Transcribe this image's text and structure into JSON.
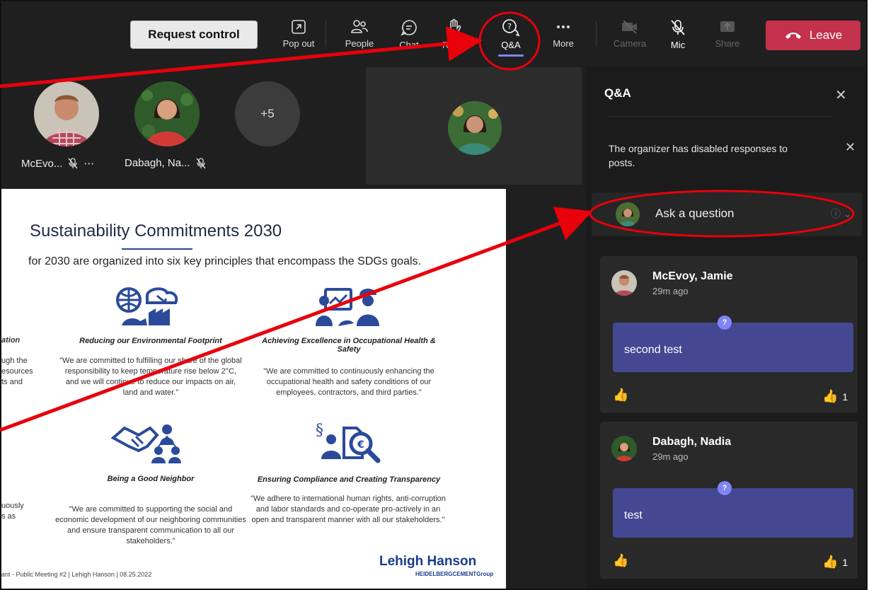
{
  "toolbar": {
    "request_control": "Request control",
    "buttons": [
      {
        "label": "Pop out",
        "icon": "pop-out-icon"
      },
      {
        "label": "People",
        "icon": "people-icon"
      },
      {
        "label": "Chat",
        "icon": "chat-icon"
      },
      {
        "label": "React",
        "icon": "hand-icon"
      },
      {
        "label": "Q&A",
        "icon": "qa-icon",
        "active": true
      },
      {
        "label": "More",
        "icon": "more-icon"
      },
      {
        "label": "Camera",
        "icon": "camera-icon",
        "disabled": true
      },
      {
        "label": "Mic",
        "icon": "mic-off-icon"
      },
      {
        "label": "Share",
        "icon": "share-icon",
        "disabled": true
      }
    ],
    "leave": "Leave"
  },
  "participants": [
    {
      "name": "McEvo...",
      "more": "⋯"
    },
    {
      "name": "Dabagh, Na..."
    }
  ],
  "overflow_count": "+5",
  "slide": {
    "title": "Sustainability Commitments 2030",
    "subtitle": "for 2030 are organized into six key principles that encompass the SDGs goals.",
    "clip_left_head": "ation",
    "clip_left_1": "ugh the",
    "clip_left_2": "esources",
    "clip_left_3": "ts and",
    "clip_left_4": "uously",
    "clip_left_5": "s as",
    "p1_head": "Reducing our Environmental Footprint",
    "p1_body": "\"We are committed to fulfilling our share of the global responsibility to keep temperature rise below 2°C, and we will continue to reduce our impacts on air, land and water.\"",
    "p2_head": "Achieving Excellence in Occupational Health & Safety",
    "p2_body": "\"We are committed to continuously enhancing the occupational health and safety conditions of our employees, contractors, and third parties.\"",
    "p3_head": "Being a Good Neighbor",
    "p3_body": "\"We are committed to supporting the social and economic development of our neighboring communities and ensure transparent communication to all our stakeholders.\"",
    "p4_head": "Ensuring Compliance and Creating Transparency",
    "p4_body": "\"We adhere to international human rights, anti-corruption and labor standards and co-operate pro-actively in an open and transparent manner with all our stakeholders.\"",
    "footer": "ant - Public Meeting #2  |  Lehigh Hanson  |  08.25.2022",
    "logo_main": "Lehigh Hanson",
    "logo_sub": "HEIDELBERGCEMENTGroup"
  },
  "qa": {
    "title": "Q&A",
    "notice": "The organizer has disabled responses to posts.",
    "ask_placeholder": "Ask a question",
    "posts": [
      {
        "author": "McEvoy, Jamie",
        "time": "29m ago",
        "text": "second test",
        "likes": "1"
      },
      {
        "author": "Dabagh, Nadia",
        "time": "29m ago",
        "text": "test",
        "likes": "1"
      }
    ]
  },
  "colors": {
    "leave": "#c4314b",
    "accent": "#7f85f5",
    "bubble": "#444791",
    "annotation": "#e8000b"
  }
}
